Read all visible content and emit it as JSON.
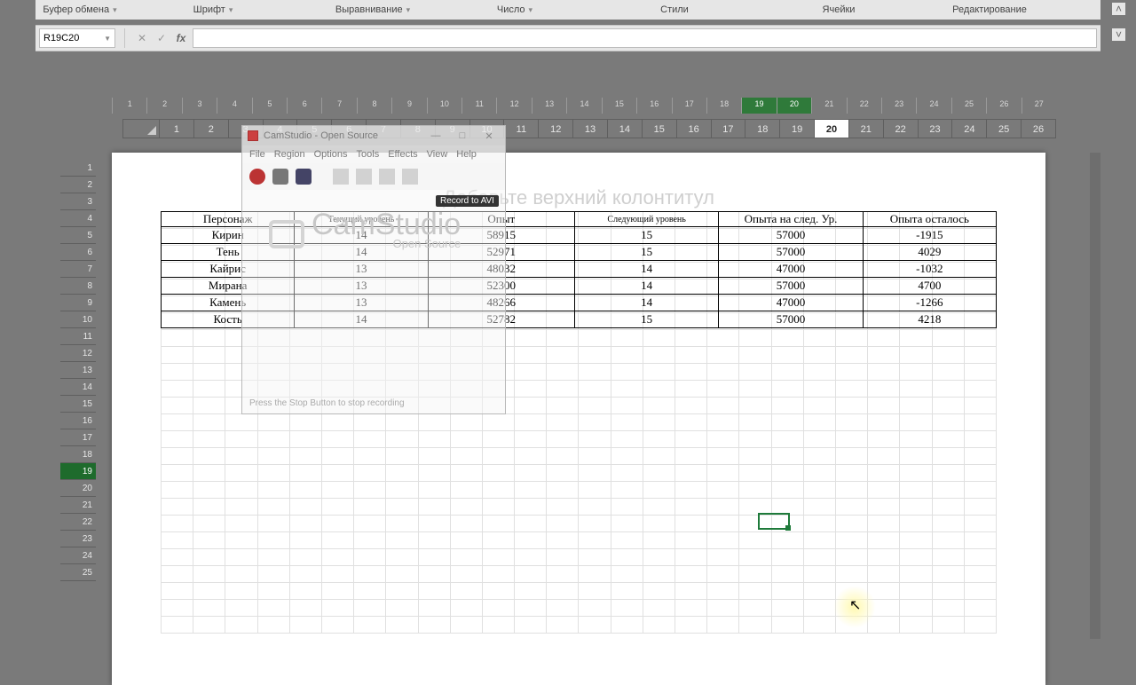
{
  "ribbon_groups": [
    "Буфер обмена",
    "Шрифт",
    "Выравнивание",
    "Число",
    "Стили",
    "Ячейки",
    "Редактирование"
  ],
  "namebox": "R19C20",
  "header_placeholder": "Добавьте верхний колонтитул",
  "ruler_top": [
    "1",
    "2",
    "3",
    "4",
    "5",
    "6",
    "7",
    "8",
    "9",
    "10",
    "11",
    "12",
    "13",
    "14",
    "15",
    "16",
    "17",
    "18",
    "19",
    "20",
    "21",
    "22",
    "23",
    "24",
    "25",
    "26",
    "27"
  ],
  "ruler_sel": [
    "19",
    "20"
  ],
  "col_headers": [
    "1",
    "2",
    "3",
    "4",
    "5",
    "6",
    "7",
    "8",
    "9",
    "10",
    "11",
    "12",
    "13",
    "14",
    "15",
    "16",
    "17",
    "18",
    "19",
    "20",
    "21",
    "22",
    "23",
    "24",
    "25",
    "26"
  ],
  "col_sel": "20",
  "row_headers": [
    "1",
    "2",
    "3",
    "4",
    "5",
    "6",
    "7",
    "8",
    "9",
    "10",
    "11",
    "12",
    "13",
    "14",
    "15",
    "16",
    "17",
    "18",
    "19",
    "20",
    "21",
    "22",
    "23",
    "24",
    "25"
  ],
  "row_sel": "19",
  "table": {
    "headers": [
      "Персонаж",
      "Текущий уровень",
      "Опыт",
      "Следующий уровень",
      "Опыта на след. Ур.",
      "Опыта осталось"
    ],
    "rows": [
      [
        "Кирин",
        "14",
        "58915",
        "15",
        "57000",
        "-1915"
      ],
      [
        "Тень",
        "14",
        "52971",
        "15",
        "57000",
        "4029"
      ],
      [
        "Кайрис",
        "13",
        "48032",
        "14",
        "47000",
        "-1032"
      ],
      [
        "Мирана",
        "13",
        "52300",
        "14",
        "57000",
        "4700"
      ],
      [
        "Камень",
        "13",
        "48266",
        "14",
        "47000",
        "-1266"
      ],
      [
        "Кость",
        "14",
        "52782",
        "15",
        "57000",
        "4218"
      ]
    ]
  },
  "cam": {
    "title": "CamStudio - Open Source",
    "menu": [
      "File",
      "Region",
      "Options",
      "Tools",
      "Effects",
      "View",
      "Help"
    ],
    "tooltip": "Record to AVI",
    "brand": "CamStudio",
    "brand_sub": "Open Source",
    "footer": "Press the Stop Button to stop recording"
  }
}
